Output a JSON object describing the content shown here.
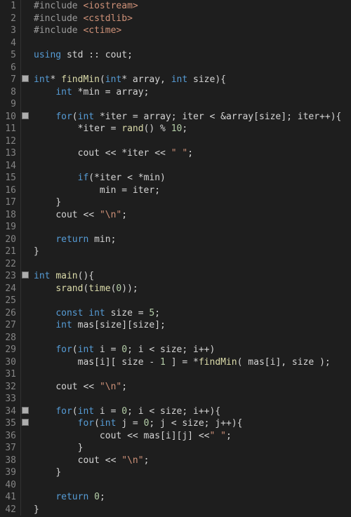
{
  "lines": [
    {
      "n": "1",
      "fold": false,
      "tokens": [
        [
          "c-pre",
          "#include "
        ],
        [
          "c-inc",
          "<iostream>"
        ]
      ]
    },
    {
      "n": "2",
      "fold": false,
      "tokens": [
        [
          "c-pre",
          "#include "
        ],
        [
          "c-inc",
          "<cstdlib>"
        ]
      ]
    },
    {
      "n": "3",
      "fold": false,
      "tokens": [
        [
          "c-pre",
          "#include "
        ],
        [
          "c-inc",
          "<ctime>"
        ]
      ]
    },
    {
      "n": "4",
      "fold": false,
      "tokens": [
        [
          "c-pl",
          ""
        ]
      ]
    },
    {
      "n": "5",
      "fold": false,
      "tokens": [
        [
          "c-kw",
          "using"
        ],
        [
          "c-pl",
          " std "
        ],
        [
          "c-op",
          "::"
        ],
        [
          "c-pl",
          " cout"
        ],
        [
          "c-op",
          ";"
        ]
      ]
    },
    {
      "n": "6",
      "fold": false,
      "tokens": [
        [
          "c-pl",
          ""
        ]
      ]
    },
    {
      "n": "7",
      "fold": true,
      "foldTop": "112",
      "tokens": [
        [
          "c-type",
          "int"
        ],
        [
          "c-op",
          "* "
        ],
        [
          "c-fn",
          "findMin"
        ],
        [
          "c-br",
          "("
        ],
        [
          "c-type",
          "int"
        ],
        [
          "c-op",
          "* "
        ],
        [
          "c-pl",
          "array"
        ],
        [
          "c-op",
          ", "
        ],
        [
          "c-type",
          "int"
        ],
        [
          "c-pl",
          " size"
        ],
        [
          "c-br",
          ")"
        ],
        [
          "c-br",
          "{"
        ]
      ]
    },
    {
      "n": "8",
      "fold": false,
      "tokens": [
        [
          "ind",
          "    "
        ],
        [
          "c-type",
          "int"
        ],
        [
          "c-pl",
          " "
        ],
        [
          "c-op",
          "*"
        ],
        [
          "c-pl",
          "min "
        ],
        [
          "c-op",
          "="
        ],
        [
          "c-pl",
          " array"
        ],
        [
          "c-op",
          ";"
        ]
      ]
    },
    {
      "n": "9",
      "fold": false,
      "tokens": [
        [
          "c-pl",
          ""
        ]
      ]
    },
    {
      "n": "10",
      "fold": true,
      "foldTop": "165",
      "tokens": [
        [
          "ind",
          "    "
        ],
        [
          "c-kw",
          "for"
        ],
        [
          "c-br",
          "("
        ],
        [
          "c-type",
          "int"
        ],
        [
          "c-pl",
          " "
        ],
        [
          "c-op",
          "*"
        ],
        [
          "c-pl",
          "iter "
        ],
        [
          "c-op",
          "="
        ],
        [
          "c-pl",
          " array"
        ],
        [
          "c-op",
          ";"
        ],
        [
          "c-pl",
          " iter "
        ],
        [
          "c-op",
          "<"
        ],
        [
          "c-pl",
          " "
        ],
        [
          "c-op",
          "&"
        ],
        [
          "c-pl",
          "array"
        ],
        [
          "c-br",
          "["
        ],
        [
          "c-pl",
          "size"
        ],
        [
          "c-br",
          "]"
        ],
        [
          "c-op",
          ";"
        ],
        [
          "c-pl",
          " iter"
        ],
        [
          "c-op",
          "++"
        ],
        [
          "c-br",
          ")"
        ],
        [
          "c-br",
          "{"
        ]
      ]
    },
    {
      "n": "11",
      "fold": false,
      "tokens": [
        [
          "ind",
          "        "
        ],
        [
          "c-op",
          "*"
        ],
        [
          "c-pl",
          "iter "
        ],
        [
          "c-op",
          "="
        ],
        [
          "c-pl",
          " "
        ],
        [
          "c-fn",
          "rand"
        ],
        [
          "c-br",
          "()"
        ],
        [
          "c-pl",
          " "
        ],
        [
          "c-op",
          "%"
        ],
        [
          "c-pl",
          " "
        ],
        [
          "c-num",
          "10"
        ],
        [
          "c-op",
          ";"
        ]
      ]
    },
    {
      "n": "12",
      "fold": false,
      "tokens": [
        [
          "c-pl",
          ""
        ]
      ]
    },
    {
      "n": "13",
      "fold": false,
      "tokens": [
        [
          "ind",
          "        "
        ],
        [
          "c-pl",
          "cout "
        ],
        [
          "c-op",
          "<<"
        ],
        [
          "c-pl",
          " "
        ],
        [
          "c-op",
          "*"
        ],
        [
          "c-pl",
          "iter "
        ],
        [
          "c-op",
          "<<"
        ],
        [
          "c-pl",
          " "
        ],
        [
          "c-str",
          "\" \""
        ],
        [
          "c-op",
          ";"
        ]
      ]
    },
    {
      "n": "14",
      "fold": false,
      "tokens": [
        [
          "c-pl",
          ""
        ]
      ]
    },
    {
      "n": "15",
      "fold": false,
      "tokens": [
        [
          "ind",
          "        "
        ],
        [
          "c-kw",
          "if"
        ],
        [
          "c-br",
          "("
        ],
        [
          "c-op",
          "*"
        ],
        [
          "c-pl",
          "iter "
        ],
        [
          "c-op",
          "<"
        ],
        [
          "c-pl",
          " "
        ],
        [
          "c-op",
          "*"
        ],
        [
          "c-pl",
          "min"
        ],
        [
          "c-br",
          ")"
        ]
      ]
    },
    {
      "n": "16",
      "fold": false,
      "tokens": [
        [
          "ind",
          "            "
        ],
        [
          "c-pl",
          "min "
        ],
        [
          "c-op",
          "="
        ],
        [
          "c-pl",
          " iter"
        ],
        [
          "c-op",
          ";"
        ]
      ]
    },
    {
      "n": "17",
      "fold": false,
      "tokens": [
        [
          "ind",
          "    "
        ],
        [
          "c-br",
          "}"
        ]
      ]
    },
    {
      "n": "18",
      "fold": false,
      "tokens": [
        [
          "ind",
          "    "
        ],
        [
          "c-pl",
          "cout "
        ],
        [
          "c-op",
          "<<"
        ],
        [
          "c-pl",
          " "
        ],
        [
          "c-str",
          "\"\\n\""
        ],
        [
          "c-op",
          ";"
        ]
      ]
    },
    {
      "n": "19",
      "fold": false,
      "tokens": [
        [
          "c-pl",
          ""
        ]
      ]
    },
    {
      "n": "20",
      "fold": false,
      "tokens": [
        [
          "ind",
          "    "
        ],
        [
          "c-kw",
          "return"
        ],
        [
          "c-pl",
          " min"
        ],
        [
          "c-op",
          ";"
        ]
      ]
    },
    {
      "n": "21",
      "fold": false,
      "tokens": [
        [
          "c-br",
          "}"
        ]
      ]
    },
    {
      "n": "22",
      "fold": false,
      "tokens": [
        [
          "c-pl",
          ""
        ]
      ]
    },
    {
      "n": "23",
      "fold": true,
      "foldTop": "394",
      "tokens": [
        [
          "c-type",
          "int"
        ],
        [
          "c-pl",
          " "
        ],
        [
          "c-fn",
          "main"
        ],
        [
          "c-br",
          "()"
        ],
        [
          "c-br",
          "{"
        ]
      ]
    },
    {
      "n": "24",
      "fold": false,
      "tokens": [
        [
          "ind",
          "    "
        ],
        [
          "c-fn",
          "srand"
        ],
        [
          "c-br",
          "("
        ],
        [
          "c-fn",
          "time"
        ],
        [
          "c-br",
          "("
        ],
        [
          "c-num",
          "0"
        ],
        [
          "c-br",
          "))"
        ],
        [
          "c-op",
          ";"
        ]
      ]
    },
    {
      "n": "25",
      "fold": false,
      "tokens": [
        [
          "c-pl",
          ""
        ]
      ]
    },
    {
      "n": "26",
      "fold": false,
      "tokens": [
        [
          "ind",
          "    "
        ],
        [
          "c-kw",
          "const"
        ],
        [
          "c-pl",
          " "
        ],
        [
          "c-type",
          "int"
        ],
        [
          "c-pl",
          " size "
        ],
        [
          "c-op",
          "="
        ],
        [
          "c-pl",
          " "
        ],
        [
          "c-num",
          "5"
        ],
        [
          "c-op",
          ";"
        ]
      ]
    },
    {
      "n": "27",
      "fold": false,
      "tokens": [
        [
          "ind",
          "    "
        ],
        [
          "c-type",
          "int"
        ],
        [
          "c-pl",
          " mas"
        ],
        [
          "c-br",
          "["
        ],
        [
          "c-pl",
          "size"
        ],
        [
          "c-br",
          "]["
        ],
        [
          "c-pl",
          "size"
        ],
        [
          "c-br",
          "]"
        ],
        [
          "c-op",
          ";"
        ]
      ]
    },
    {
      "n": "28",
      "fold": false,
      "tokens": [
        [
          "c-pl",
          ""
        ]
      ]
    },
    {
      "n": "29",
      "fold": false,
      "tokens": [
        [
          "ind",
          "    "
        ],
        [
          "c-kw",
          "for"
        ],
        [
          "c-br",
          "("
        ],
        [
          "c-type",
          "int"
        ],
        [
          "c-pl",
          " i "
        ],
        [
          "c-op",
          "="
        ],
        [
          "c-pl",
          " "
        ],
        [
          "c-num",
          "0"
        ],
        [
          "c-op",
          ";"
        ],
        [
          "c-pl",
          " i "
        ],
        [
          "c-op",
          "<"
        ],
        [
          "c-pl",
          " size"
        ],
        [
          "c-op",
          ";"
        ],
        [
          "c-pl",
          " i"
        ],
        [
          "c-op",
          "++"
        ],
        [
          "c-br",
          ")"
        ]
      ]
    },
    {
      "n": "30",
      "fold": false,
      "tokens": [
        [
          "ind",
          "        "
        ],
        [
          "c-pl",
          "mas"
        ],
        [
          "c-br",
          "["
        ],
        [
          "c-pl",
          "i"
        ],
        [
          "c-br",
          "]["
        ],
        [
          "c-pl",
          " size "
        ],
        [
          "c-op",
          "-"
        ],
        [
          "c-pl",
          " "
        ],
        [
          "c-num",
          "1"
        ],
        [
          "c-pl",
          " "
        ],
        [
          "c-br",
          "]"
        ],
        [
          "c-pl",
          " "
        ],
        [
          "c-op",
          "="
        ],
        [
          "c-pl",
          " "
        ],
        [
          "c-op",
          "*"
        ],
        [
          "c-fn",
          "findMin"
        ],
        [
          "c-br",
          "("
        ],
        [
          "c-pl",
          " mas"
        ],
        [
          "c-br",
          "["
        ],
        [
          "c-pl",
          "i"
        ],
        [
          "c-br",
          "]"
        ],
        [
          "c-op",
          ","
        ],
        [
          "c-pl",
          " size "
        ],
        [
          "c-br",
          ")"
        ],
        [
          "c-op",
          ";"
        ]
      ]
    },
    {
      "n": "31",
      "fold": false,
      "tokens": [
        [
          "c-pl",
          ""
        ]
      ]
    },
    {
      "n": "32",
      "fold": false,
      "tokens": [
        [
          "ind",
          "    "
        ],
        [
          "c-pl",
          "cout "
        ],
        [
          "c-op",
          "<<"
        ],
        [
          "c-pl",
          " "
        ],
        [
          "c-str",
          "\"\\n\""
        ],
        [
          "c-op",
          ";"
        ]
      ]
    },
    {
      "n": "33",
      "fold": false,
      "tokens": [
        [
          "c-pl",
          ""
        ]
      ]
    },
    {
      "n": "34",
      "fold": true,
      "foldTop": "588",
      "tokens": [
        [
          "ind",
          "    "
        ],
        [
          "c-kw",
          "for"
        ],
        [
          "c-br",
          "("
        ],
        [
          "c-type",
          "int"
        ],
        [
          "c-pl",
          " i "
        ],
        [
          "c-op",
          "="
        ],
        [
          "c-pl",
          " "
        ],
        [
          "c-num",
          "0"
        ],
        [
          "c-op",
          ";"
        ],
        [
          "c-pl",
          " i "
        ],
        [
          "c-op",
          "<"
        ],
        [
          "c-pl",
          " size"
        ],
        [
          "c-op",
          ";"
        ],
        [
          "c-pl",
          " i"
        ],
        [
          "c-op",
          "++"
        ],
        [
          "c-br",
          ")"
        ],
        [
          "c-br",
          "{"
        ]
      ]
    },
    {
      "n": "35",
      "fold": true,
      "foldTop": "605",
      "tokens": [
        [
          "ind",
          "        "
        ],
        [
          "c-kw",
          "for"
        ],
        [
          "c-br",
          "("
        ],
        [
          "c-type",
          "int"
        ],
        [
          "c-pl",
          " j "
        ],
        [
          "c-op",
          "="
        ],
        [
          "c-pl",
          " "
        ],
        [
          "c-num",
          "0"
        ],
        [
          "c-op",
          ";"
        ],
        [
          "c-pl",
          " j "
        ],
        [
          "c-op",
          "<"
        ],
        [
          "c-pl",
          " size"
        ],
        [
          "c-op",
          ";"
        ],
        [
          "c-pl",
          " j"
        ],
        [
          "c-op",
          "++"
        ],
        [
          "c-br",
          ")"
        ],
        [
          "c-br",
          "{"
        ]
      ]
    },
    {
      "n": "36",
      "fold": false,
      "tokens": [
        [
          "ind",
          "            "
        ],
        [
          "c-pl",
          "cout "
        ],
        [
          "c-op",
          "<<"
        ],
        [
          "c-pl",
          " mas"
        ],
        [
          "c-br",
          "["
        ],
        [
          "c-pl",
          "i"
        ],
        [
          "c-br",
          "]["
        ],
        [
          "c-pl",
          "j"
        ],
        [
          "c-br",
          "]"
        ],
        [
          "c-pl",
          " "
        ],
        [
          "c-op",
          "<<"
        ],
        [
          "c-str",
          "\" \""
        ],
        [
          "c-op",
          ";"
        ]
      ]
    },
    {
      "n": "37",
      "fold": false,
      "tokens": [
        [
          "ind",
          "        "
        ],
        [
          "c-br",
          "}"
        ]
      ]
    },
    {
      "n": "38",
      "fold": false,
      "tokens": [
        [
          "ind",
          "        "
        ],
        [
          "c-pl",
          "cout "
        ],
        [
          "c-op",
          "<<"
        ],
        [
          "c-pl",
          " "
        ],
        [
          "c-str",
          "\"\\n\""
        ],
        [
          "c-op",
          ";"
        ]
      ]
    },
    {
      "n": "39",
      "fold": false,
      "tokens": [
        [
          "ind",
          "    "
        ],
        [
          "c-br",
          "}"
        ]
      ]
    },
    {
      "n": "40",
      "fold": false,
      "tokens": [
        [
          "c-pl",
          ""
        ]
      ]
    },
    {
      "n": "41",
      "fold": false,
      "tokens": [
        [
          "ind",
          "    "
        ],
        [
          "c-kw",
          "return"
        ],
        [
          "c-pl",
          " "
        ],
        [
          "c-num",
          "0"
        ],
        [
          "c-op",
          ";"
        ]
      ]
    },
    {
      "n": "42",
      "fold": false,
      "tokens": [
        [
          "c-br",
          "}"
        ]
      ]
    }
  ]
}
